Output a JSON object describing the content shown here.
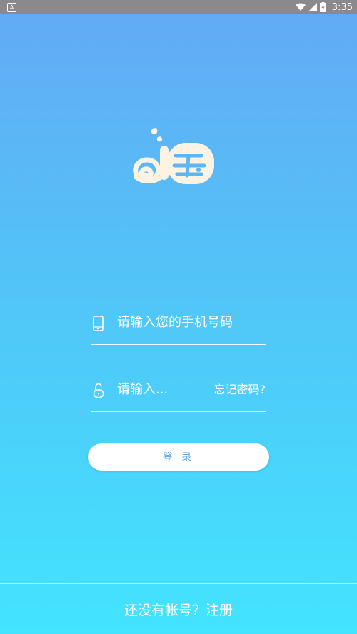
{
  "status_bar": {
    "notification_icon": "A",
    "time": "3:35",
    "icons": [
      "wifi-icon",
      "signal-icon",
      "battery-charging-icon"
    ]
  },
  "logo": {
    "name": "app-logo"
  },
  "form": {
    "phone_placeholder": "请输入您的手机号码",
    "password_placeholder": "请输入...",
    "forgot_label": "忘记密码?",
    "login_label": "登 录"
  },
  "footer": {
    "register_text": "还没有帐号？注册"
  },
  "colors": {
    "gradient_top": "#64a9f5",
    "gradient_bottom": "#42e4ff",
    "button_text": "#5aa6e8"
  }
}
